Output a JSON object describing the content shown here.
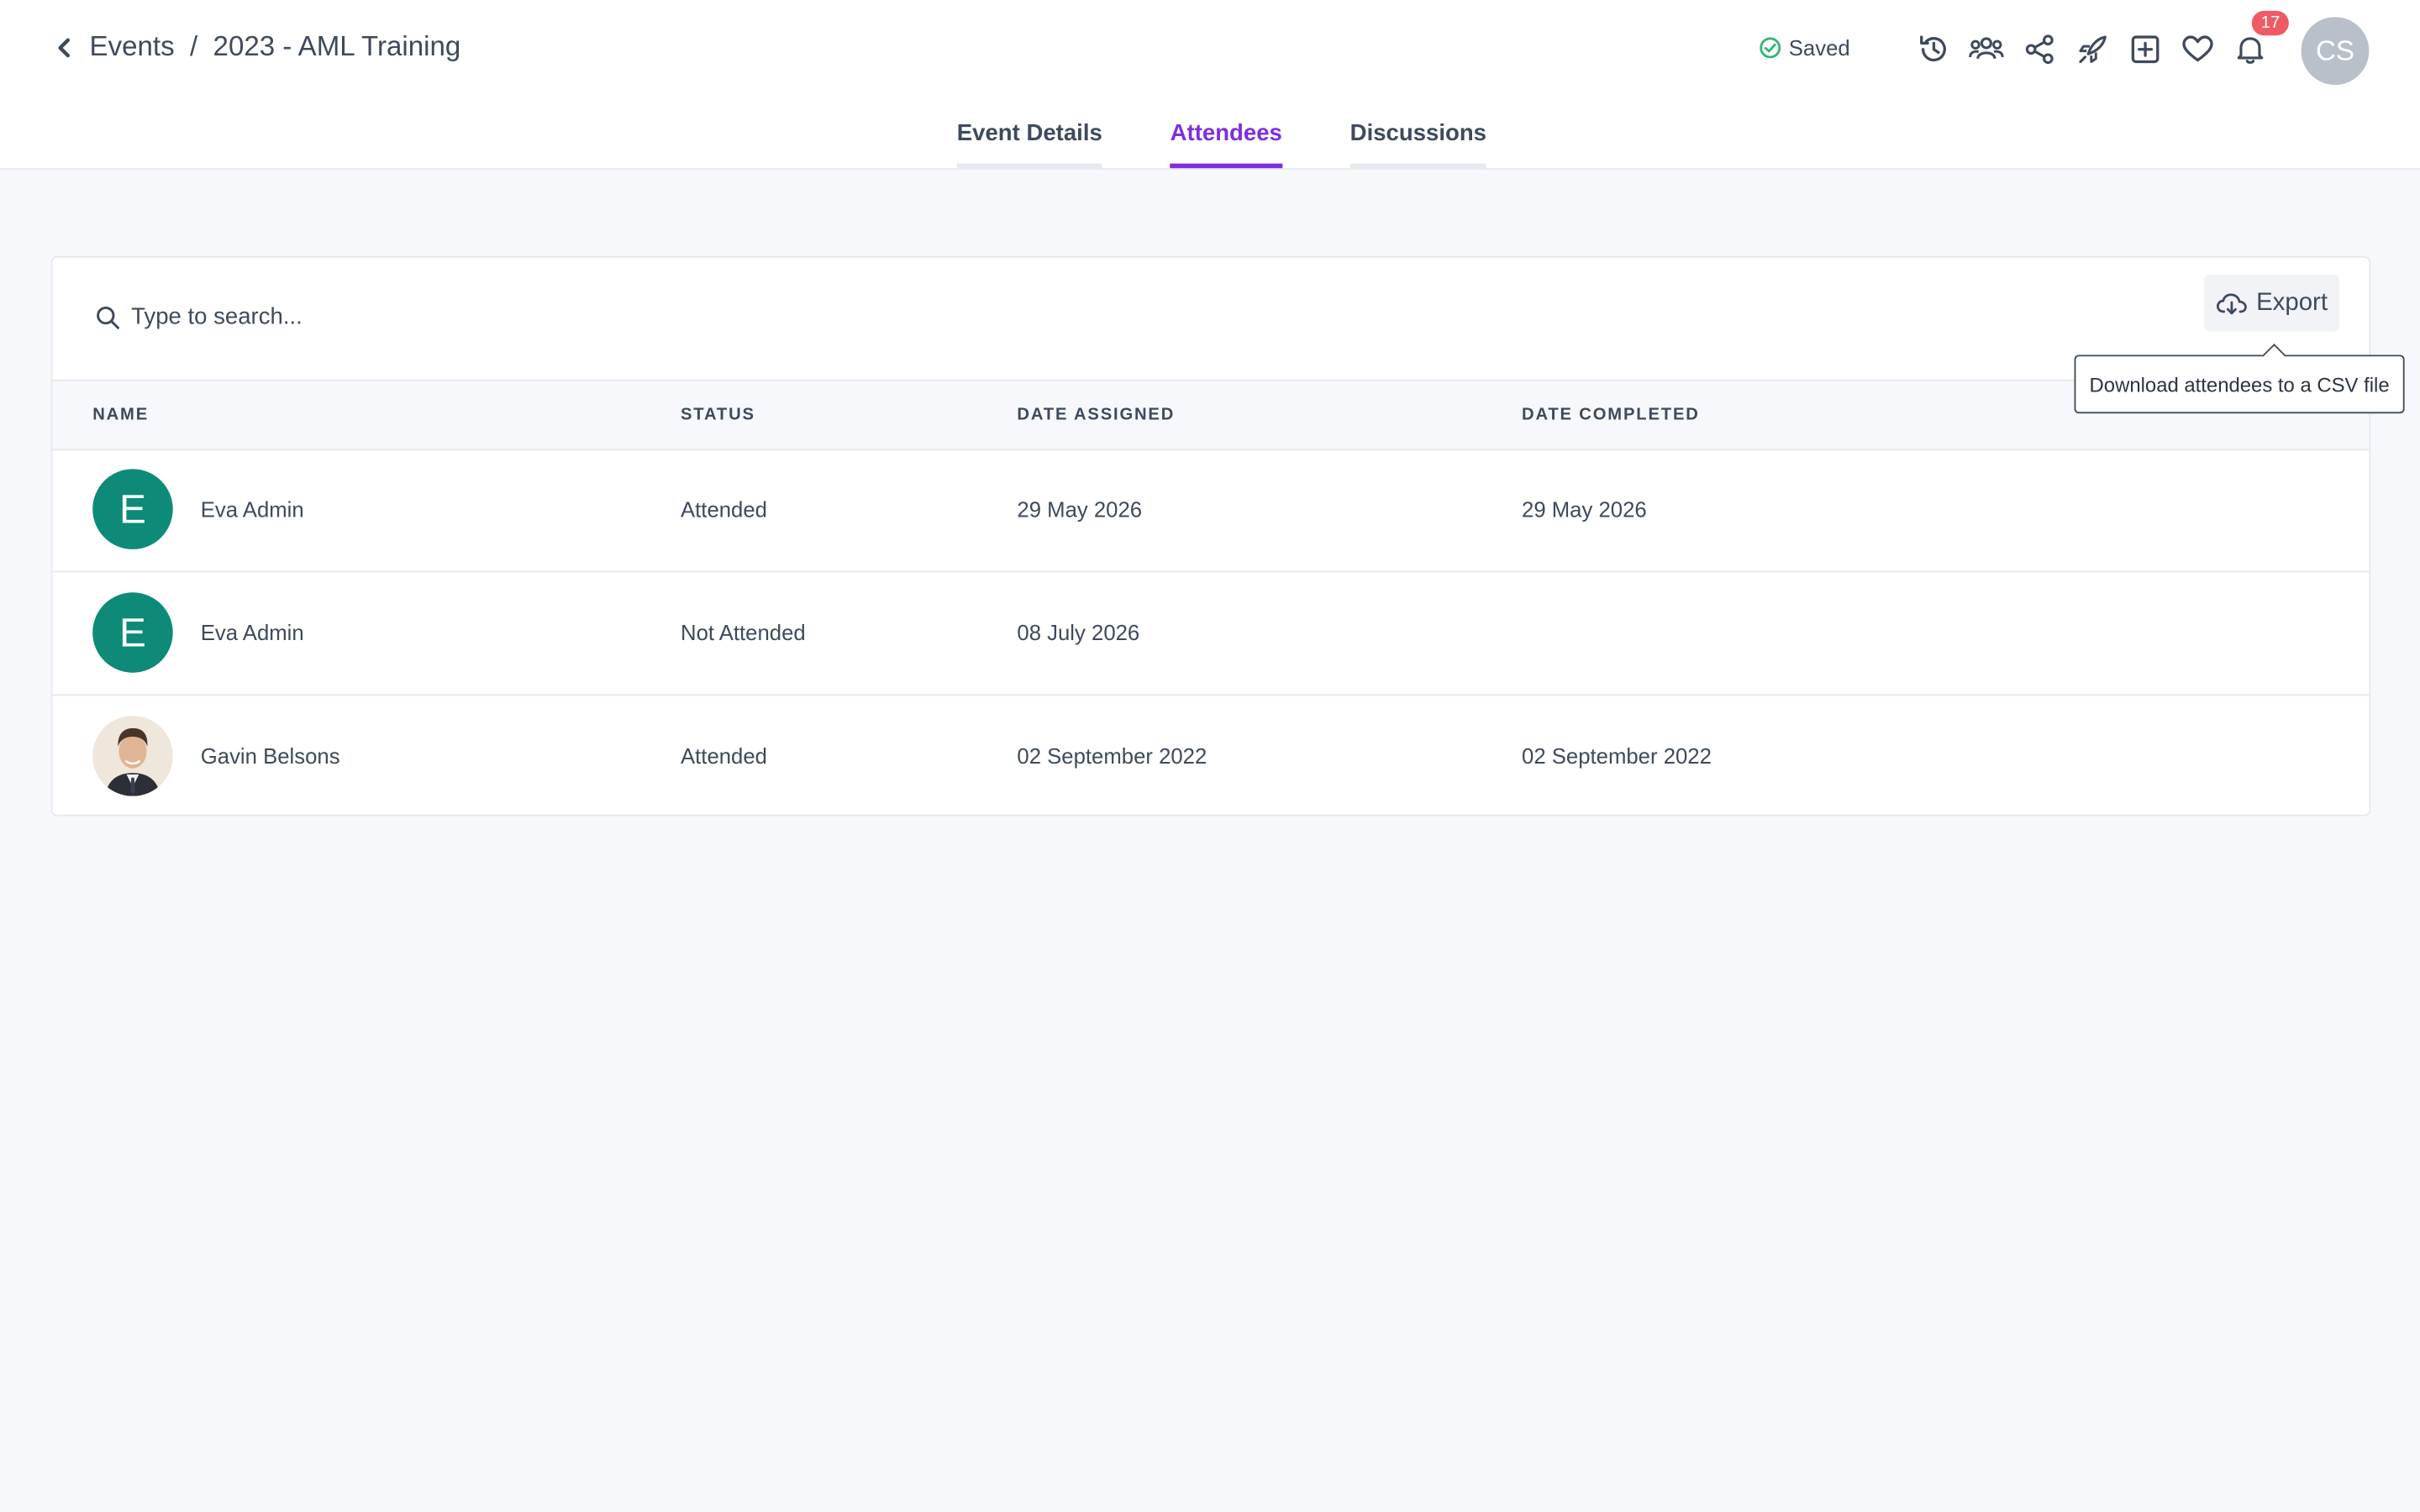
{
  "breadcrumb": {
    "root": "Events",
    "separator": "/",
    "current": "2023 - AML Training"
  },
  "status": {
    "saved": "Saved"
  },
  "notifications": {
    "count": "17"
  },
  "user": {
    "initials": "CS"
  },
  "tabs": [
    {
      "label": "Event Details"
    },
    {
      "label": "Attendees"
    },
    {
      "label": "Discussions"
    }
  ],
  "search": {
    "placeholder": "Type to search..."
  },
  "export": {
    "label": "Export",
    "tooltip": "Download attendees to a CSV file"
  },
  "table": {
    "headers": [
      "NAME",
      "STATUS",
      "DATE ASSIGNED",
      "DATE COMPLETED"
    ],
    "rows": [
      {
        "initial": "E",
        "name": "Eva Admin",
        "status": "Attended",
        "assigned": "29 May 2026",
        "completed": "29 May 2026"
      },
      {
        "initial": "E",
        "name": "Eva Admin",
        "status": "Not Attended",
        "assigned": "08 July 2026",
        "completed": ""
      },
      {
        "initial": "",
        "name": "Gavin Belsons",
        "status": "Attended",
        "assigned": "02 September 2022",
        "completed": "02 September 2022"
      }
    ]
  },
  "colors": {
    "accent": "#7e2ee0",
    "avatar_bg": "#0e8a78",
    "badge": "#ef5a65",
    "saved_check": "#2bb673"
  },
  "icons": [
    "chevron-left-icon",
    "check-circle-icon",
    "history-icon",
    "users-icon",
    "share-icon",
    "rocket-icon",
    "plus-square-icon",
    "heart-icon",
    "bell-icon",
    "search-icon",
    "cloud-download-icon"
  ]
}
